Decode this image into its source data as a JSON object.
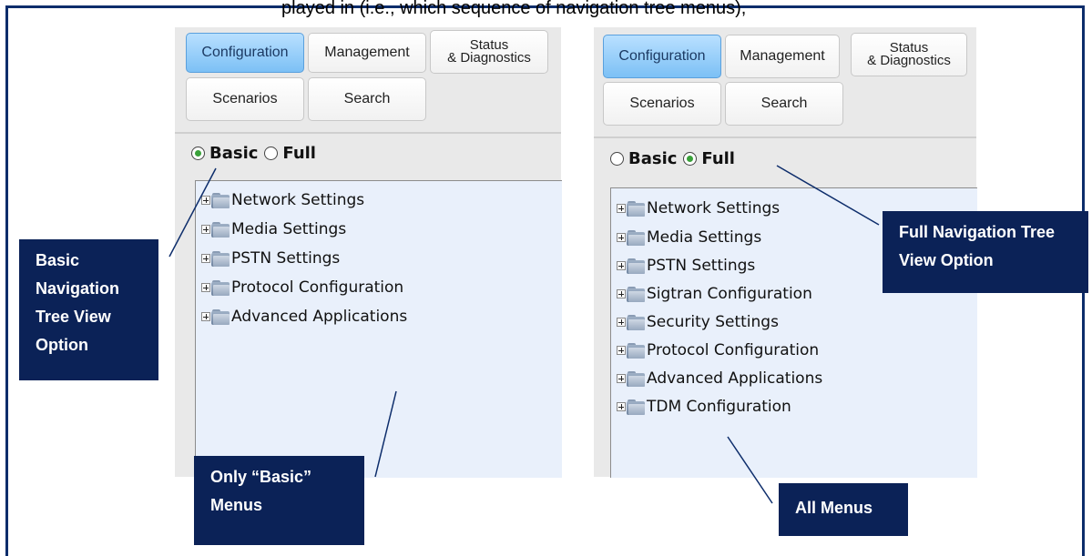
{
  "caption": "played in (i.e., which sequence of navigation tree menus),",
  "left_panel": {
    "tabs": [
      "Configuration",
      "Management",
      "Status\n& Diagnostics",
      "Scenarios",
      "Search"
    ],
    "radio_basic": "Basic",
    "radio_full": "Full",
    "selected": "Basic",
    "tree": [
      "Network Settings",
      "Media Settings",
      "PSTN Settings",
      "Protocol Configuration",
      "Advanced Applications"
    ]
  },
  "right_panel": {
    "tabs": [
      "Configuration",
      "Management",
      "Status\n& Diagnostics",
      "Scenarios",
      "Search"
    ],
    "radio_basic": "Basic",
    "radio_full": "Full",
    "selected": "Full",
    "tree": [
      "Network Settings",
      "Media Settings",
      "PSTN Settings",
      "Sigtran Configuration",
      "Security Settings",
      "Protocol Configuration",
      "Advanced Applications",
      "TDM Configuration"
    ]
  },
  "callouts": {
    "basic_nav": "Basic Navigation Tree View Option",
    "only_basic": "Only “Basic” Menus",
    "full_nav": "Full Navigation Tree View Option",
    "all_menus": "All Menus"
  },
  "colors": {
    "callout_bg": "#0b2257",
    "frame": "#0d2d6b",
    "active_tab": "#7cc0f5",
    "tree_bg": "#e9f0fb",
    "radio_dot": "#3aa13a"
  }
}
